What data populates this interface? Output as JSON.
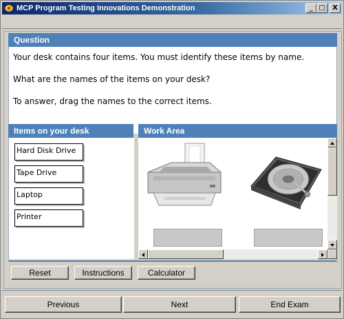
{
  "window": {
    "title": "MCP Program Testing Innovations Demonstration",
    "controls": {
      "minimize": "_",
      "maximize": "□",
      "close": "X"
    }
  },
  "question": {
    "header": "Question",
    "lines": [
      "Your desk contains four items. You must identify these items by name.",
      "What are the names of the items on your desk?",
      "To answer, drag the names to the correct items."
    ]
  },
  "items_panel": {
    "header": "Items on your desk",
    "items": [
      "Hard Disk Drive",
      "Tape Drive",
      "Laptop",
      "Printer"
    ]
  },
  "work_area": {
    "header": "Work Area",
    "images": [
      "printer-image",
      "hard-disk-image"
    ]
  },
  "toolbar": {
    "reset": "Reset",
    "instructions": "Instructions",
    "calculator": "Calculator"
  },
  "navigation": {
    "previous": "Previous",
    "next": "Next",
    "end_exam": "End Exam"
  },
  "colors": {
    "panel_header": "#4f81b8",
    "title_bar": "#0a246a",
    "drop_target": "#c8c8c8"
  }
}
